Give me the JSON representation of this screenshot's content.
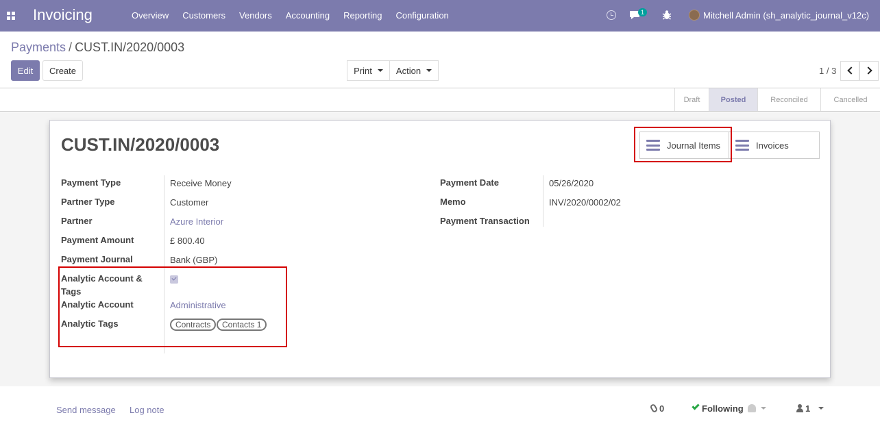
{
  "app": {
    "brand": "Invoicing",
    "menu": [
      "Overview",
      "Customers",
      "Vendors",
      "Accounting",
      "Reporting",
      "Configuration"
    ],
    "chat_count": "1",
    "user": "Mitchell Admin (sh_analytic_journal_v12c)"
  },
  "breadcrumb": {
    "parent": "Payments",
    "separator": "/",
    "current": "CUST.IN/2020/0003"
  },
  "buttons": {
    "edit": "Edit",
    "create": "Create",
    "print": "Print",
    "action": "Action"
  },
  "pager": {
    "value": "1 / 3"
  },
  "statusbar": {
    "stages": [
      "Draft",
      "Posted",
      "Reconciled",
      "Cancelled"
    ],
    "active": "Posted"
  },
  "record": {
    "title": "CUST.IN/2020/0003",
    "smart_buttons": {
      "journal_items": "Journal Items",
      "invoices": "Invoices"
    },
    "left_fields": [
      {
        "label": "Payment Type",
        "value": "Receive Money"
      },
      {
        "label": "Partner Type",
        "value": "Customer"
      },
      {
        "label": "Partner",
        "value": "Azure Interior"
      },
      {
        "label": "Payment Amount",
        "value": "£ 800.40"
      },
      {
        "label": "Payment Journal",
        "value": "Bank (GBP)"
      },
      {
        "label": "Analytic Account & Tags",
        "value": ""
      },
      {
        "label": "Analytic Account",
        "value": "Administrative"
      },
      {
        "label": "Analytic Tags",
        "value": ""
      }
    ],
    "analytic_checked": true,
    "tags": [
      "Contracts",
      "Contacts 1"
    ],
    "right_fields": [
      {
        "label": "Payment Date",
        "value": "05/26/2020"
      },
      {
        "label": "Memo",
        "value": "INV/2020/0002/02"
      },
      {
        "label": "Payment Transaction",
        "value": ""
      }
    ]
  },
  "chatter": {
    "send_message": "Send message",
    "log_note": "Log note",
    "attachments": "0",
    "following": "Following",
    "followers": "1"
  }
}
